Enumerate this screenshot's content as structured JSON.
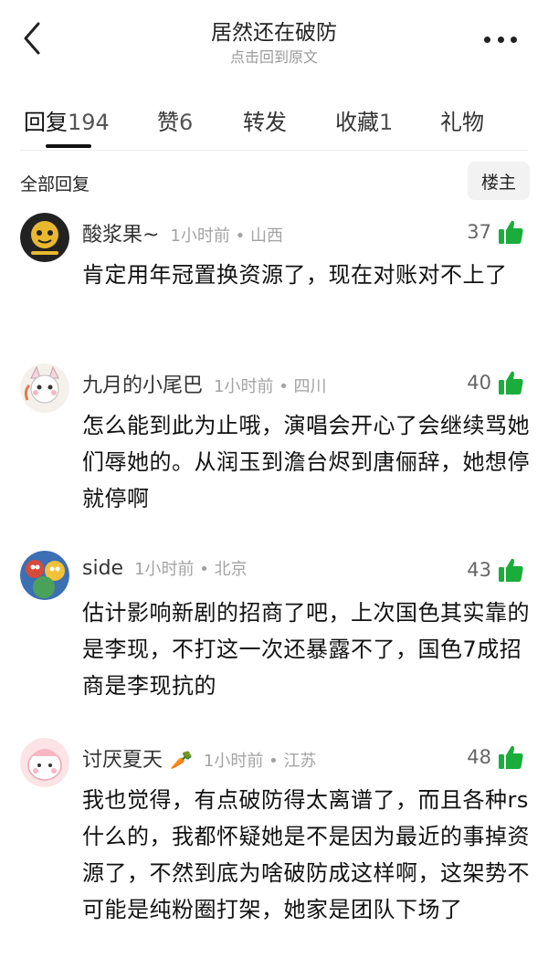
{
  "header": {
    "title": "居然还在破防",
    "subtitle": "点击回到原文"
  },
  "tabs": [
    {
      "label": "回复",
      "count": "194"
    },
    {
      "label": "赞",
      "count": "6"
    },
    {
      "label": "转发",
      "count": ""
    },
    {
      "label": "收藏",
      "count": "1"
    },
    {
      "label": "礼物",
      "count": ""
    }
  ],
  "replies_bar": {
    "label": "全部回复",
    "op_button": "楼主"
  },
  "comments": [
    {
      "username": "酸浆果~",
      "time": "1小时前",
      "location": "山西",
      "likes": "37",
      "text": "肯定用年冠置换资源了，现在对账对不上了"
    },
    {
      "username": "九月的小尾巴",
      "time": "1小时前",
      "location": "四川",
      "likes": "40",
      "text": "怎么能到此为止哦，演唱会开心了会继续骂她们辱她的。从润玉到澹台烬到唐俪辞，她想停就停啊"
    },
    {
      "username": "side",
      "time": "1小时前",
      "location": "北京",
      "likes": "43",
      "text": "估计影响新剧的招商了吧，上次国色其实靠的是李现，不打这一次还暴露不了，国色7成招商是李现抗的"
    },
    {
      "username": "讨厌夏天",
      "badge": "🥕",
      "time": "1小时前",
      "location": "江苏",
      "likes": "48",
      "text": "我也觉得，有点破防得太离谱了，而且各种rs什么的，我都怀疑她是不是因为最近的事掉资源了，不然到底为啥破防成这样啊，这架势不可能是纯粉圈打架，她家是团队下场了"
    }
  ],
  "colors": {
    "like_green": "#1aad3b",
    "meta_gray": "#a3a3a3"
  },
  "icons": {
    "back": "chevron-left-icon",
    "more": "more-dots-icon",
    "like": "thumbs-up-icon"
  }
}
